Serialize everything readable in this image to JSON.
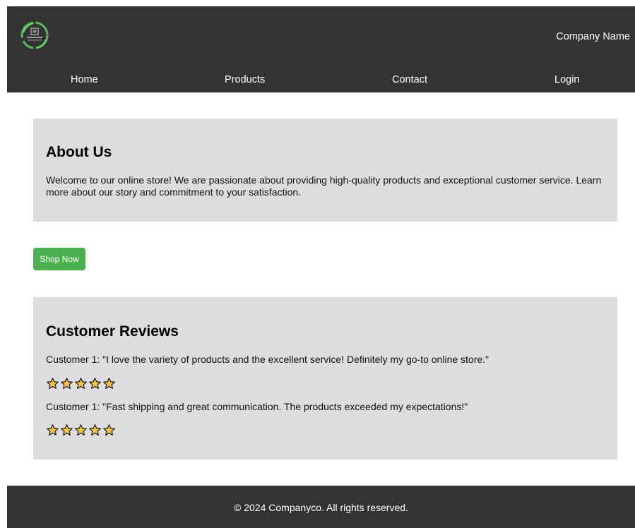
{
  "header": {
    "company_name": "Company Name",
    "logo_icon": "leaf-ring-logo-icon"
  },
  "nav": {
    "items": [
      {
        "label": "Home"
      },
      {
        "label": "Products"
      },
      {
        "label": "Contact"
      },
      {
        "label": "Login"
      }
    ]
  },
  "about": {
    "heading": "About Us",
    "text": "Welcome to our online store! We are passionate about providing high-quality products and exceptional customer service. Learn more about our story and commitment to your satisfaction."
  },
  "shop_button": {
    "label": "Shop Now"
  },
  "reviews": {
    "heading": "Customer Reviews",
    "items": [
      {
        "text": "Customer 1: \"I love the variety of products and the excellent service! Definitely my go-to online store.\"",
        "rating": 5,
        "rating_max": 5
      },
      {
        "text": "Customer 1: \"Fast shipping and great communication. The products exceeded my expectations!\"",
        "rating": 5,
        "rating_max": 5
      }
    ]
  },
  "footer": {
    "text": "© 2024 Companyco. All rights reserved."
  },
  "colors": {
    "header_bg": "#333333",
    "section_bg": "#dddddd",
    "button_bg": "#4caf50",
    "star_fill": "#f5c242",
    "logo_green": "#5cb85c"
  }
}
